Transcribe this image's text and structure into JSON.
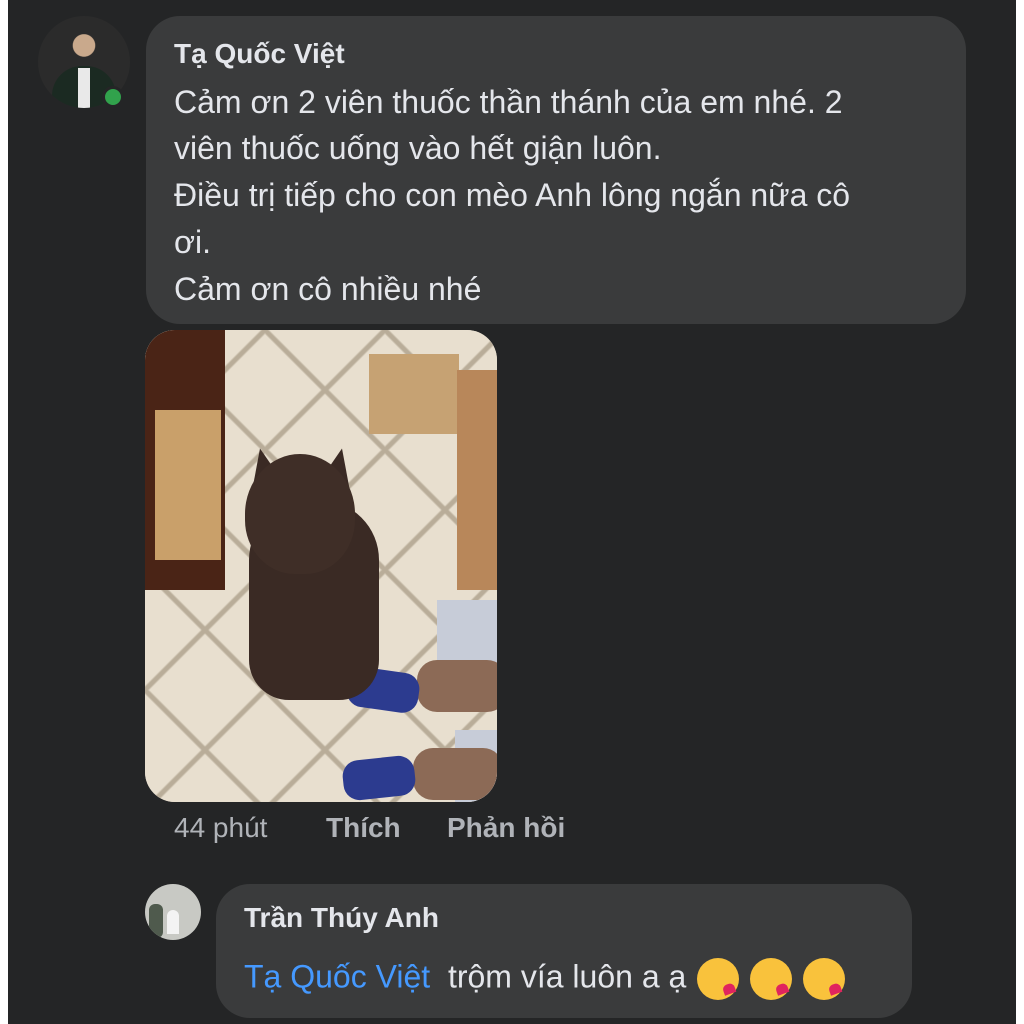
{
  "comment": {
    "author": "Tạ Quốc Việt",
    "lines": [
      "Cảm ơn 2 viên thuốc thần thánh của em nhé. 2",
      "viên thuốc uống vào hết giận luôn.",
      "Điều trị tiếp cho con mèo Anh lông ngắn nữa cô",
      "ơi.",
      "Cảm ơn cô nhiều nhé"
    ],
    "time": "44 phút",
    "like_label": "Thích",
    "reply_label": "Phản hồi",
    "online": true
  },
  "reply": {
    "author": "Trần Thúy Anh",
    "mention": "Tạ Quốc Việt",
    "text": "trộm vía luôn a ạ",
    "emojis": [
      "😘",
      "😘",
      "😘"
    ]
  },
  "colors": {
    "background": "#242526",
    "bubble": "#3a3b3c",
    "text": "#e4e6eb",
    "meta": "#b0b3b8",
    "mention": "#4599ff",
    "online": "#31a24c"
  }
}
